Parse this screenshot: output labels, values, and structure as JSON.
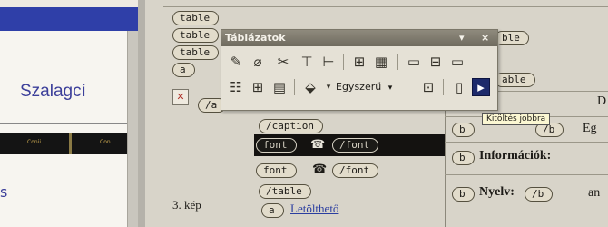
{
  "preview": {
    "title": "Szalagcí",
    "bar_left": "Conii",
    "bar_right": "Con",
    "bullet": "s"
  },
  "editor": {
    "tags": {
      "table1": "table",
      "table2": "table",
      "table3": "table",
      "a1": "a",
      "a_close": "/a",
      "caption_close": "/caption",
      "font_open1": "font",
      "font_close1": "/font",
      "font_open2": "font",
      "font_close2": "/font",
      "table_close": "/table",
      "a2": "a",
      "ble1": "ble",
      "ble2": "able",
      "b1": "b",
      "b1_close": "/b",
      "b2": "b",
      "b3": "b",
      "b3_close": "/b"
    },
    "caption_text": "3. kép",
    "link_text": "Letölthető",
    "right_d": "D",
    "right_eg": "Eg",
    "right_info": "Információk:",
    "right_nyelv": "Nyelv:",
    "right_an": "an",
    "x_icon": "close-x"
  },
  "toolbar": {
    "title": "Táblázatok",
    "dropdown_glyph": "▾",
    "close_glyph": "×",
    "style_select": "Egyszerű",
    "tooltip": "Kitöltés jobbra"
  },
  "colors": {
    "highlight_button": "#1d2a6b",
    "link": "#2b3ea0",
    "preview_title": "#3c3f9a"
  }
}
